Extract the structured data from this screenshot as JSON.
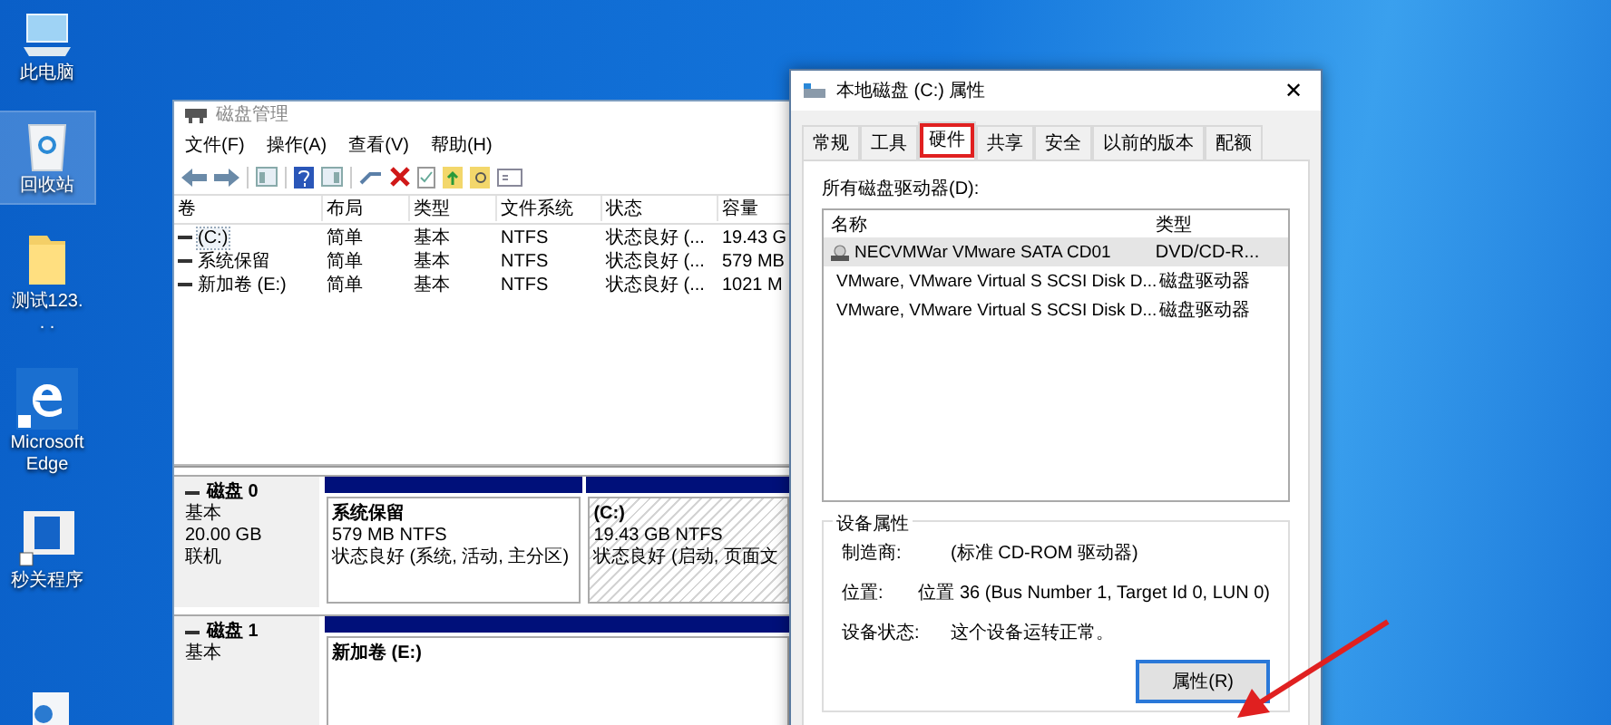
{
  "desktop_icons": [
    {
      "label": "此电脑",
      "kind": "computer",
      "selected": false
    },
    {
      "label": "回收站",
      "kind": "recycle-bin",
      "selected": true
    },
    {
      "label": "测试123.\n. .",
      "kind": "folder",
      "selected": false
    },
    {
      "label": "Microsoft\nEdge",
      "kind": "edge",
      "selected": false
    },
    {
      "label": "秒关程序",
      "kind": "app",
      "selected": false
    }
  ],
  "disk_management": {
    "title": "磁盘管理",
    "menu": [
      "文件(F)",
      "操作(A)",
      "查看(V)",
      "帮助(H)"
    ],
    "columns": [
      "卷",
      "布局",
      "类型",
      "文件系统",
      "状态",
      "容量"
    ],
    "rows": [
      {
        "cells": [
          "(C:)",
          "简单",
          "基本",
          "NTFS",
          "状态良好 (...",
          "19.43 G"
        ],
        "selected": true
      },
      {
        "cells": [
          "系统保留",
          "简单",
          "基本",
          "NTFS",
          "状态良好 (...",
          "579 MB"
        ],
        "selected": false
      },
      {
        "cells": [
          "新加卷 (E:)",
          "简单",
          "基本",
          "NTFS",
          "状态良好 (...",
          "1021 M"
        ],
        "selected": false
      }
    ],
    "disks": [
      {
        "name": "磁盘 0",
        "type": "基本",
        "size": "20.00 GB",
        "status": "联机",
        "partitions": [
          {
            "name": "系统保留",
            "size": "579 MB NTFS",
            "status": "状态良好 (系统, 活动, 主分区)",
            "selected": false
          },
          {
            "name": "(C:)",
            "size": "19.43 GB NTFS",
            "status": "状态良好 (启动, 页面文",
            "selected": true
          }
        ]
      },
      {
        "name": "磁盘 1",
        "type": "基本",
        "partitions": [
          {
            "name": "新加卷  (E:)",
            "selected": false
          }
        ]
      }
    ]
  },
  "properties_dialog": {
    "title": "本地磁盘 (C:) 属性",
    "close": "✕",
    "tabs": [
      {
        "label": "常规",
        "selected": false,
        "outlined": false
      },
      {
        "label": "工具",
        "selected": false,
        "outlined": false
      },
      {
        "label": "硬件",
        "selected": true,
        "outlined": true
      },
      {
        "label": "共享",
        "selected": false,
        "outlined": false
      },
      {
        "label": "安全",
        "selected": false,
        "outlined": false
      },
      {
        "label": "以前的版本",
        "selected": false,
        "outlined": false
      },
      {
        "label": "配额",
        "selected": false,
        "outlined": false
      }
    ],
    "drives_label": "所有磁盘驱动器(D):",
    "columns": [
      "名称",
      "类型"
    ],
    "drives": [
      {
        "name": "NECVMWar VMware SATA CD01",
        "type": "DVD/CD-R...",
        "kind": "cdrom",
        "selected": true
      },
      {
        "name": "VMware, VMware Virtual S SCSI Disk D...",
        "type": "磁盘驱动器",
        "kind": "disk",
        "selected": false
      },
      {
        "name": "VMware, VMware Virtual S SCSI Disk D...",
        "type": "磁盘驱动器",
        "kind": "disk",
        "selected": false
      }
    ],
    "device_properties": {
      "title": "设备属性",
      "fields": [
        {
          "label": "制造商:",
          "value": "(标准 CD-ROM 驱动器)"
        },
        {
          "label": "位置:",
          "value": "位置 36 (Bus Number 1, Target Id 0, LUN 0)"
        },
        {
          "label": "设备状态:",
          "value": "这个设备运转正常。"
        }
      ]
    },
    "button": "属性(R)"
  }
}
